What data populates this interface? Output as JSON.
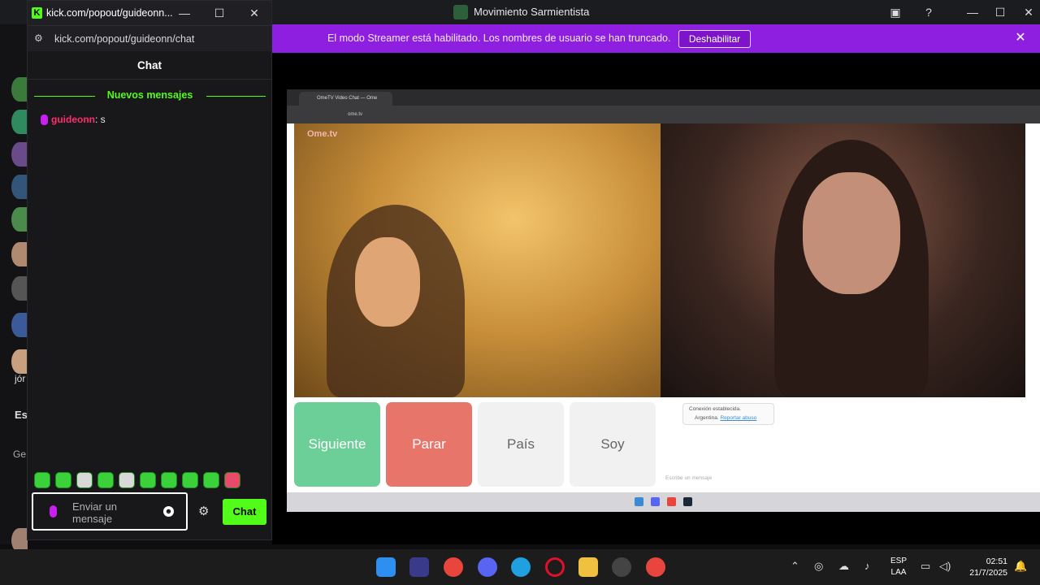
{
  "window": {
    "title": "Movimiento Sarmientista"
  },
  "banner": {
    "text": "El modo Streamer está habilitado. Los nombres de usuario se han truncado.",
    "disable_label": "Deshabilitar"
  },
  "popout": {
    "title": "kick.com/popout/guideonn...",
    "url": "kick.com/popout/guideonn/chat",
    "chat_header": "Chat",
    "new_messages_label": "Nuevos mensajes",
    "message": {
      "user": "guideonn",
      "text": ": s"
    },
    "input_placeholder": "Enviar un mensaje",
    "send_label": "Chat"
  },
  "sidebar": {
    "partial_1": "jór",
    "partial_2": "Es",
    "partial_3": "Ge"
  },
  "inner_browser": {
    "tab_title": "OmeTV Video Chat — Ome",
    "url": "ome.tv",
    "logo": "Ome.tv",
    "buttons": {
      "next": "Siguiente",
      "stop": "Parar",
      "country": "País",
      "gender": "Soy"
    },
    "connection": {
      "title": "Conexión establecida.",
      "country": "Argentina.",
      "report": "Reportar abuso"
    },
    "input_placeholder": "Escribe un mensaje"
  },
  "taskbar": {
    "lang_1": "ESP",
    "lang_2": "LAA",
    "time": "02:51",
    "date": "21/7/2025"
  },
  "colors": {
    "kick_green": "#53fc18",
    "banner_purple": "#8f1fe0",
    "username_pink": "#ff2d6f"
  }
}
